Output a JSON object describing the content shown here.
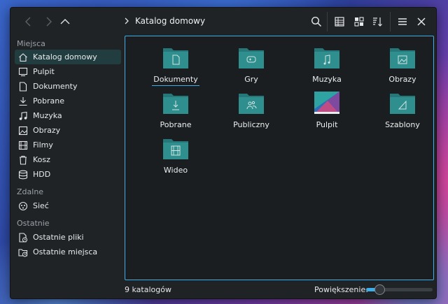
{
  "breadcrumb": {
    "current": "Katalog domowy"
  },
  "sidebar": {
    "sections": [
      {
        "title": "Miejsca",
        "items": [
          {
            "label": "Katalog domowy",
            "icon": "home-icon",
            "active": true
          },
          {
            "label": "Pulpit",
            "icon": "desktop-icon"
          },
          {
            "label": "Dokumenty",
            "icon": "document-icon"
          },
          {
            "label": "Pobrane",
            "icon": "download-icon"
          },
          {
            "label": "Muzyka",
            "icon": "music-icon"
          },
          {
            "label": "Obrazy",
            "icon": "image-icon"
          },
          {
            "label": "Filmy",
            "icon": "film-icon"
          },
          {
            "label": "Kosz",
            "icon": "trash-icon"
          },
          {
            "label": "HDD",
            "icon": "drive-icon"
          }
        ]
      },
      {
        "title": "Zdalne",
        "items": [
          {
            "label": "Sieć",
            "icon": "network-icon"
          }
        ]
      },
      {
        "title": "Ostatnie",
        "items": [
          {
            "label": "Ostatnie pliki",
            "icon": "recent-files-icon"
          },
          {
            "label": "Ostatnie miejsca",
            "icon": "recent-places-icon"
          }
        ]
      }
    ]
  },
  "files": [
    {
      "label": "Dokumenty",
      "icon": "folder-documents-icon",
      "focused": true
    },
    {
      "label": "Gry",
      "icon": "folder-games-icon"
    },
    {
      "label": "Muzyka",
      "icon": "folder-music-icon"
    },
    {
      "label": "Obrazy",
      "icon": "folder-pictures-icon"
    },
    {
      "label": "Pobrane",
      "icon": "folder-download-icon"
    },
    {
      "label": "Publiczny",
      "icon": "folder-public-icon"
    },
    {
      "label": "Pulpit",
      "icon": "desktop-folder-icon"
    },
    {
      "label": "Szablony",
      "icon": "folder-templates-icon"
    },
    {
      "label": "Wideo",
      "icon": "folder-videos-icon"
    }
  ],
  "status": {
    "summary": "9 katalogów",
    "zoom_label": "Powiększenie:",
    "zoom_level": 0.2
  },
  "colors": {
    "accent": "#3daee9",
    "folder": "#2f8f8e",
    "window_bg": "#202326",
    "view_bg": "#1b1e20"
  }
}
